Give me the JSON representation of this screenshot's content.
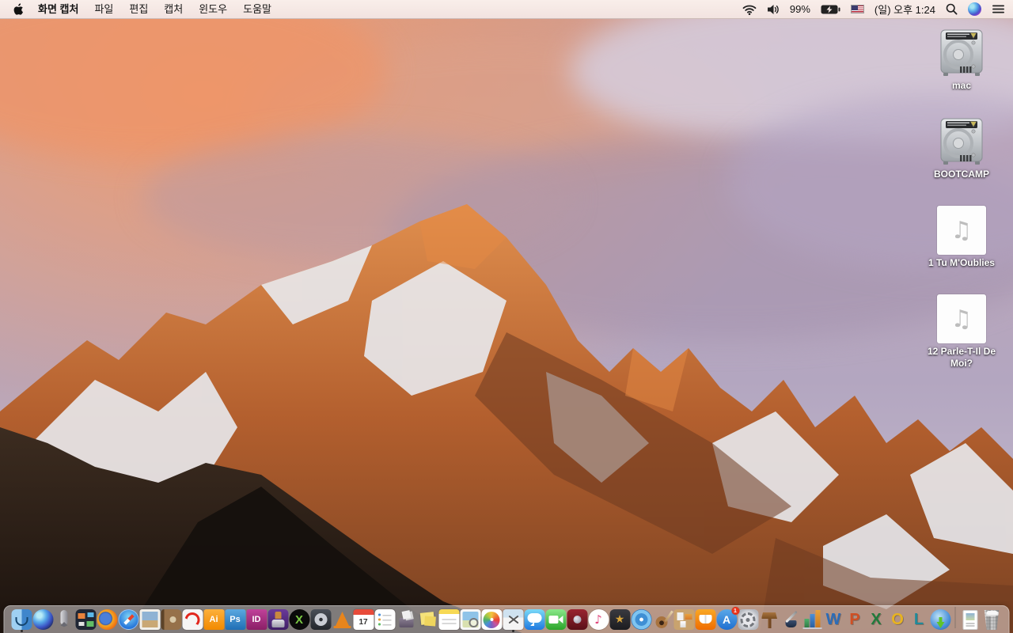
{
  "menu_bar": {
    "app_name": "화면 캡처",
    "menus": [
      "파일",
      "편집",
      "캡처",
      "윈도우",
      "도움말"
    ],
    "status": {
      "battery_percent": "99%",
      "clock": "(일) 오후 1:24",
      "icons": [
        "wifi-icon",
        "volume-icon",
        "battery-charging-icon",
        "us-flag-icon",
        "spotlight-search-icon",
        "siri-icon",
        "notification-center-icon"
      ]
    }
  },
  "desktop": {
    "icons": [
      {
        "name": "drive-mac",
        "type": "hard-drive",
        "label": "mac"
      },
      {
        "name": "drive-bootcamp",
        "type": "hard-drive",
        "label": "BOOTCAMP"
      },
      {
        "name": "music-file-1",
        "type": "audio-file",
        "label": "1 Tu M'Oublies",
        "glyph": "♫"
      },
      {
        "name": "music-file-2",
        "type": "audio-file",
        "label": "12 Parle-T-Il De Moi?",
        "glyph": "♫"
      }
    ]
  },
  "dock": {
    "items": [
      {
        "name": "finder",
        "running": true
      },
      {
        "name": "siri"
      },
      {
        "name": "launchpad"
      },
      {
        "name": "mission-control"
      },
      {
        "name": "firefox"
      },
      {
        "name": "safari"
      },
      {
        "name": "mail"
      },
      {
        "name": "contacts"
      },
      {
        "name": "acrobat"
      },
      {
        "name": "illustrator",
        "glyph": "Ai"
      },
      {
        "name": "photoshop",
        "glyph": "Ps"
      },
      {
        "name": "indesign",
        "glyph": "ID"
      },
      {
        "name": "toast"
      },
      {
        "name": "x11",
        "glyph": "X"
      },
      {
        "name": "disk-utility"
      },
      {
        "name": "vlc"
      },
      {
        "name": "calendar",
        "glyph": "17"
      },
      {
        "name": "reminders"
      },
      {
        "name": "unarchiver"
      },
      {
        "name": "stickies"
      },
      {
        "name": "notes"
      },
      {
        "name": "preview"
      },
      {
        "name": "photos"
      },
      {
        "name": "grab",
        "running": true
      },
      {
        "name": "messages"
      },
      {
        "name": "facetime"
      },
      {
        "name": "photo-booth"
      },
      {
        "name": "itunes",
        "glyph": "♪"
      },
      {
        "name": "imovie",
        "glyph": "★"
      },
      {
        "name": "dvd-player"
      },
      {
        "name": "garageband"
      },
      {
        "name": "corkboard"
      },
      {
        "name": "ibooks"
      },
      {
        "name": "app-store",
        "glyph": "A",
        "badge": "1"
      },
      {
        "name": "system-preferences"
      },
      {
        "name": "keynote"
      },
      {
        "name": "pages"
      },
      {
        "name": "numbers"
      },
      {
        "name": "word",
        "glyph": "W"
      },
      {
        "name": "powerpoint",
        "glyph": "P"
      },
      {
        "name": "excel",
        "glyph": "X"
      },
      {
        "name": "outlook",
        "glyph": "O"
      },
      {
        "name": "lync",
        "glyph": "L"
      },
      {
        "name": "download-manager"
      },
      {
        "name": "divider",
        "divider": true
      },
      {
        "name": "document"
      },
      {
        "name": "trash"
      }
    ]
  },
  "colors": {
    "menubar_bg": "#f6e9e6",
    "dock_bg": "rgba(245,241,243,0.48)",
    "badge_red": "#e8341c",
    "desktop_label_text": "#ffffff",
    "sky_top_left": "#e89a6f",
    "sky_lavender": "#b5a6bf",
    "mountain_orange": "#d4753a",
    "foreground_rock": "#241a14"
  }
}
